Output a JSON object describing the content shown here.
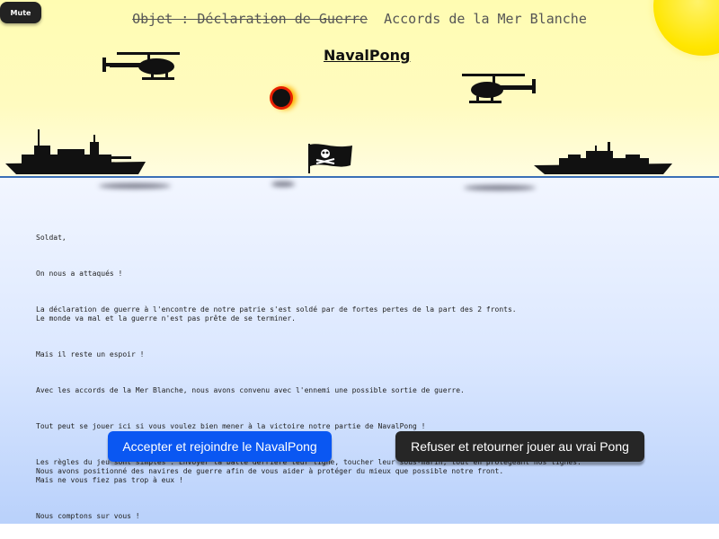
{
  "mute_label": "Mute",
  "headline": {
    "struck": "Objet : Déclaration de Guerre",
    "active": "Accords de la Mer Blanche"
  },
  "logo_text": "NavalPong",
  "letter": {
    "greeting": "Soldat,",
    "p1": "On nous a attaqués !",
    "p2": "La déclaration de guerre à l'encontre de notre patrie s'est soldé par de fortes pertes de la part des 2 fronts.\nLe monde va mal et la guerre n'est pas prête de se terminer.",
    "p3": "Mais il reste un espoir !",
    "p4": "Avec les accords de la Mer Blanche, nous avons convenu avec l'ennemi une possible sortie de guerre.",
    "p5": "Tout peut se jouer ici si vous voulez bien mener à la victoire notre partie de NavalPong !",
    "p6": "Les règles du jeu sont simples : Envoyer la balle derrière leur ligne, toucher leur sous-marin, tout en protégeant nos lignes.\nNous avons positionné des navires de guerre afin de vous aider à protéger du mieux que possible notre front.\nMais ne vous fiez pas trop à eux !",
    "p7": "Nous comptons sur vous !"
  },
  "buttons": {
    "accept": "Accepter et rejoindre le NavalPong",
    "refuse": "Refuser et retourner jouer au vrai Pong"
  },
  "colors": {
    "accept": "#0a57f2",
    "refuse": "#262626",
    "sun": "#ffe600",
    "horizon": "#3b6fb6"
  },
  "icons": [
    "helicopter-icon",
    "battleship-icon",
    "pirate-flag-icon",
    "sun-icon",
    "ball-icon"
  ]
}
